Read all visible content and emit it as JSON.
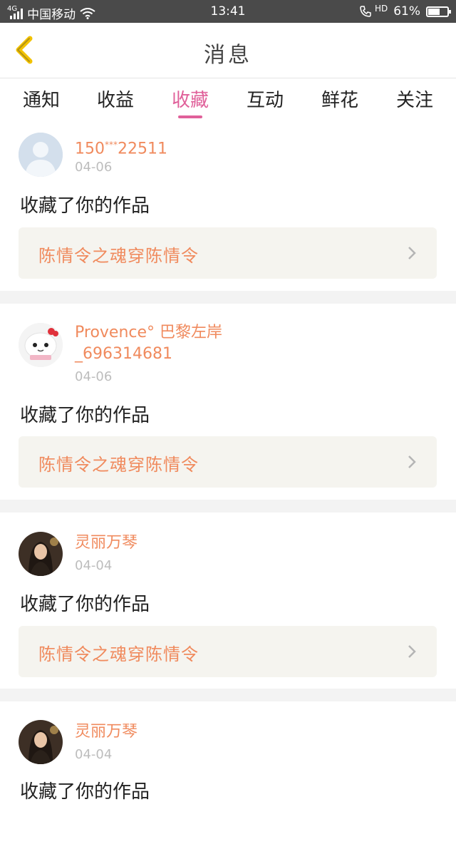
{
  "status_bar": {
    "network": "4G",
    "carrier": "中国移动",
    "time": "13:41",
    "hd": "HD",
    "battery": "61%",
    "battery_level": 0.61
  },
  "header": {
    "title": "消息",
    "back_icon": "chevron-left-icon"
  },
  "tabs": [
    {
      "label": "通知",
      "active": false
    },
    {
      "label": "收益",
      "active": false
    },
    {
      "label": "收藏",
      "active": true
    },
    {
      "label": "互动",
      "active": false
    },
    {
      "label": "鲜花",
      "active": false
    },
    {
      "label": "关注",
      "active": false
    }
  ],
  "accent_color": "#e0609a",
  "name_color": "#f08a5d",
  "items": [
    {
      "user_prefix": "150",
      "user_stars": "***",
      "user_suffix": "22511",
      "date": "04-06",
      "action": "收藏了你的作品",
      "work_title": "陈情令之魂穿陈情令"
    },
    {
      "user_line1": "Provence° 巴黎左岸",
      "user_line2": "_696314681",
      "date": "04-06",
      "action": "收藏了你的作品",
      "work_title": "陈情令之魂穿陈情令"
    },
    {
      "user": "灵丽万琴",
      "date": "04-04",
      "action": "收藏了你的作品",
      "work_title": "陈情令之魂穿陈情令"
    },
    {
      "user": "灵丽万琴",
      "date": "04-04",
      "action": "收藏了你的作品"
    }
  ]
}
